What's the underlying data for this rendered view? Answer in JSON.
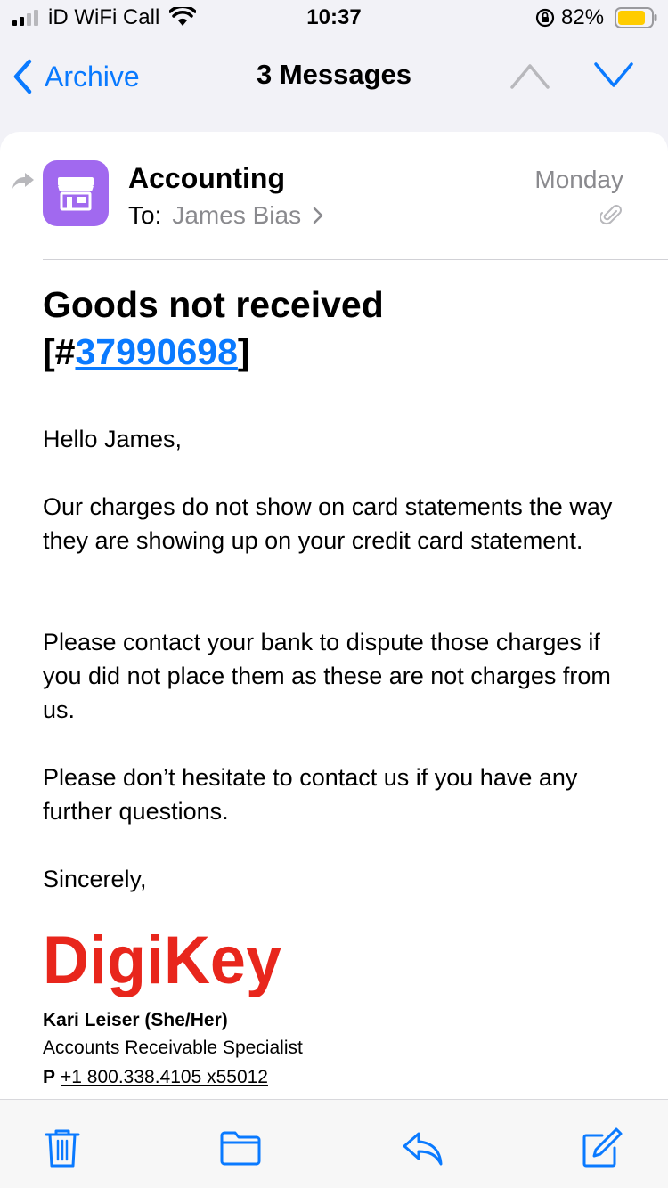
{
  "status_bar": {
    "carrier": "iD WiFi Call",
    "time": "10:37",
    "battery": "82%"
  },
  "nav": {
    "back_label": "Archive",
    "title": "3 Messages"
  },
  "message": {
    "sender": "Accounting",
    "to_label": "To:",
    "to_name": "James Bias",
    "date": "Monday",
    "subject_prefix": "Goods not received",
    "subject_open": "[#",
    "subject_ticket": "37990698",
    "subject_close": "]",
    "greeting": "Hello James,",
    "paragraphs": [
      "Our charges do not show on card statements the way they are showing up on your credit card statement.",
      "Please contact your bank to dispute those charges if you did not place them as these are not charges from us.",
      "Please don’t hesitate to contact us if you have any further questions."
    ],
    "closing": "Sincerely,",
    "logo_text": "DigiKey",
    "signature": {
      "name": "Kari Leiser (She/Her)",
      "title": "Accounts Receivable Specialist",
      "phone_label": "P",
      "phone": "+1 800.338.4105 x55012"
    }
  },
  "icons": {
    "avatar": "storefront-icon",
    "trash": "trash-icon",
    "folder": "folder-icon",
    "reply": "reply-icon",
    "compose": "compose-icon"
  },
  "colors": {
    "accent": "#0a7aff",
    "avatar_bg": "#a169ef",
    "logo_red": "#e8261c"
  }
}
